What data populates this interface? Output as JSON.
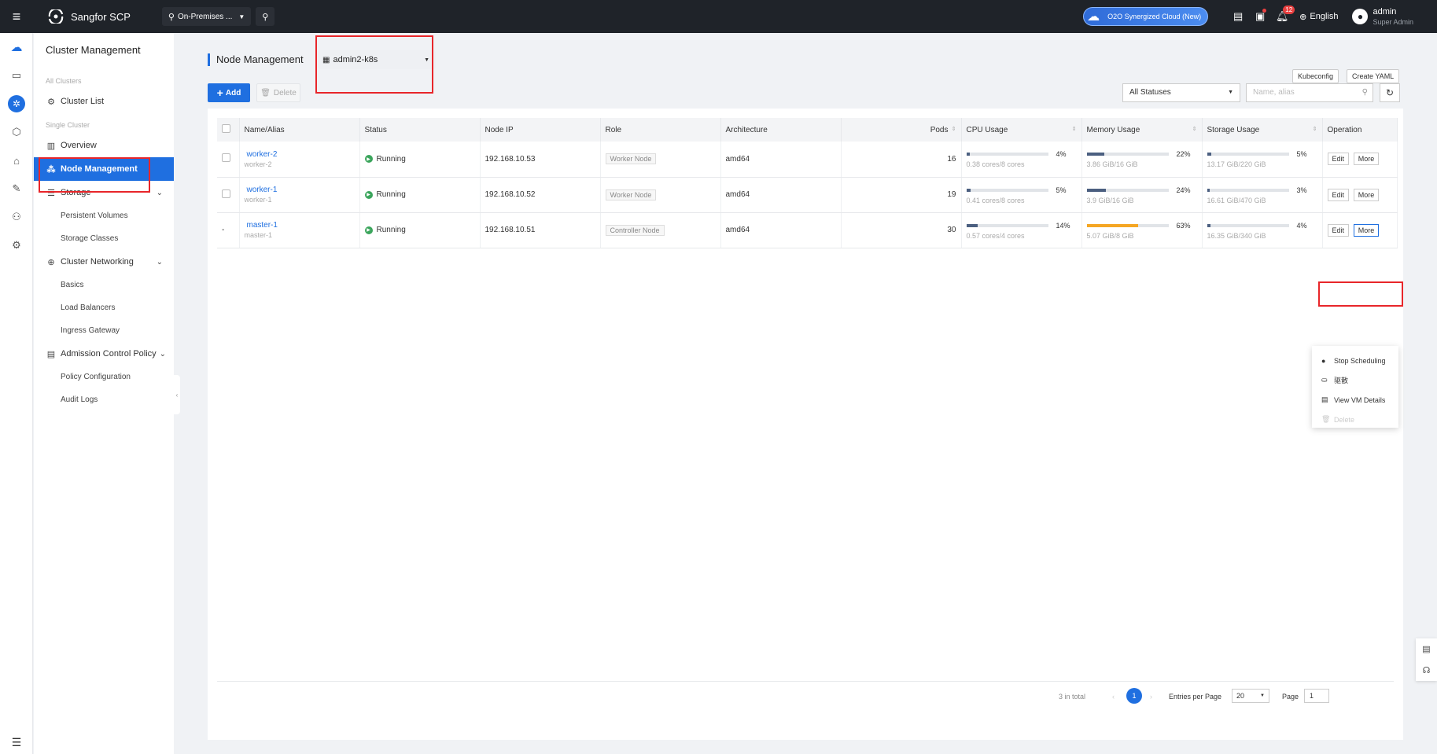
{
  "topbar": {
    "menu_icon": "hamburger-icon",
    "app_name": "Sangfor SCP",
    "region": "On-Premises ...",
    "o2o_label": "O2O Synergized Cloud (New)",
    "notification_count": "12",
    "language": "English",
    "user_name": "admin",
    "user_role": "Super Admin"
  },
  "rail": {
    "items": [
      "cloud-icon",
      "monitor-icon",
      "kubernetes-icon",
      "security-icon",
      "home-cloud-icon",
      "wrench-icon",
      "user-icon",
      "settings-icon"
    ],
    "bottom_icon": "collapse-menu-icon"
  },
  "sidebar": {
    "title": "Cluster Management",
    "group_all": "All Clusters",
    "cluster_list": "Cluster List",
    "group_single": "Single Cluster",
    "overview": "Overview",
    "node_management": "Node Management",
    "storage": "Storage",
    "persistent_volumes": "Persistent Volumes",
    "storage_classes": "Storage Classes",
    "cluster_networking": "Cluster Networking",
    "basics": "Basics",
    "load_balancers": "Load Balancers",
    "ingress_gateway": "Ingress Gateway",
    "admission_control": "Admission Control Policy",
    "policy_configuration": "Policy Configuration",
    "audit_logs": "Audit Logs"
  },
  "header": {
    "title": "Node Management",
    "cluster": "admin2-k8s",
    "kubeconfig": "Kubeconfig",
    "create_yaml": "Create YAML"
  },
  "toolbar": {
    "add": "Add",
    "delete": "Delete",
    "status_filter": "All Statuses",
    "search_placeholder": "Name, alias"
  },
  "table": {
    "columns": [
      "Name/Alias",
      "Status",
      "Node IP",
      "Role",
      "Architecture",
      "Pods",
      "CPU Usage",
      "Memory Usage",
      "Storage Usage",
      "Operation"
    ],
    "rows": [
      {
        "name": "worker-2",
        "alias": "worker-2",
        "status": "Running",
        "ip": "192.168.10.53",
        "role": "Worker Node",
        "arch": "amd64",
        "pods": "16",
        "cpu_pct": "4%",
        "cpu_val": 4,
        "cpu_sub": "0.38 cores/8 cores",
        "mem_pct": "22%",
        "mem_val": 22,
        "mem_sub": "3.86 GiB/16 GiB",
        "sto_pct": "5%",
        "sto_val": 5,
        "sto_sub": "13.17 GiB/220 GiB",
        "check": ""
      },
      {
        "name": "worker-1",
        "alias": "worker-1",
        "status": "Running",
        "ip": "192.168.10.52",
        "role": "Worker Node",
        "arch": "amd64",
        "pods": "19",
        "cpu_pct": "5%",
        "cpu_val": 5,
        "cpu_sub": "0.41 cores/8 cores",
        "mem_pct": "24%",
        "mem_val": 24,
        "mem_sub": "3.9 GiB/16 GiB",
        "sto_pct": "3%",
        "sto_val": 3,
        "sto_sub": "16.61 GiB/470 GiB",
        "check": ""
      },
      {
        "name": "master-1",
        "alias": "master-1",
        "status": "Running",
        "ip": "192.168.10.51",
        "role": "Controller Node",
        "arch": "amd64",
        "pods": "30",
        "cpu_pct": "14%",
        "cpu_val": 14,
        "cpu_sub": "0.57 cores/4 cores",
        "mem_pct": "63%",
        "mem_val": 63,
        "mem_sub": "5.07 GiB/8 GiB",
        "sto_pct": "4%",
        "sto_val": 4,
        "sto_sub": "16.35 GiB/340 GiB",
        "check": "-"
      }
    ],
    "edit": "Edit",
    "more": "More"
  },
  "dropdown": {
    "stop_scheduling": "Stop Scheduling",
    "evict": "驱散",
    "view_vm_details": "View VM Details",
    "delete": "Delete"
  },
  "pagination": {
    "total": "3 in total",
    "current_page": "1",
    "entries_label": "Entries per Page",
    "page_size": "20",
    "page_label": "Page",
    "page_input": "1"
  },
  "colors": {
    "accent": "#1f6fe0",
    "topbar": "#1f2329",
    "running": "#3ba55c",
    "warning_bar": "#f5a623",
    "highlight": "#e8262a"
  }
}
